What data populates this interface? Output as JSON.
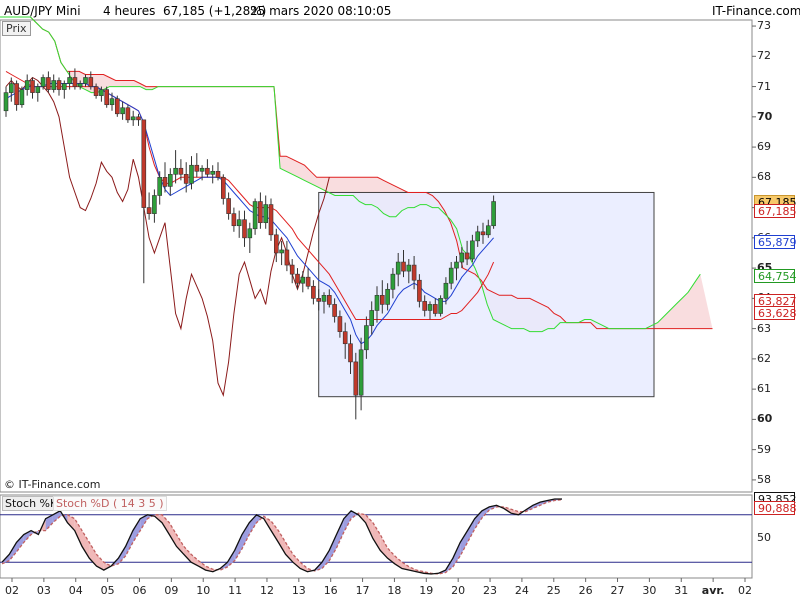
{
  "header": {
    "symbol": "AUD/JPY Mini",
    "timeframe": "4 heures",
    "last": "67,185 (+1,28%)",
    "datetime": "25 mars 2020 08:10:05",
    "brand": "IT-Finance.com",
    "price_tab": "Prix",
    "watermark": "© IT-Finance.com"
  },
  "stoch_legend": {
    "k_label": "Stoch %K",
    "d_label": "Stoch %D ( 14 3 5 )"
  },
  "colors": {
    "candle_up": "#2e9e3a",
    "candle_down": "#c0392b",
    "ma_fast": "#1f3fd1",
    "chikou": "#8b1a1a",
    "kijun_red": "#e02020",
    "senkou_green": "#33dd33",
    "cloud_fill": "#f8d9dc",
    "rect_fill": "#e8ecff",
    "stoch_k": "#111111",
    "stoch_d": "#c06060",
    "stoch_band": "#2a2a8a"
  },
  "price_labels": [
    {
      "text": "67,185",
      "value": 67.185,
      "color": "#000000",
      "bg": "#f7c96a"
    },
    {
      "text": "67,185",
      "value": 66.9,
      "color": "#cc2222",
      "bg": "#ffffff"
    },
    {
      "text": "65,879",
      "value": 65.879,
      "color": "#1f3fd1",
      "bg": "#ffffff"
    },
    {
      "text": "64,754",
      "value": 64.754,
      "color": "#229922",
      "bg": "#ffffff"
    },
    {
      "text": "63,827",
      "value": 63.92,
      "color": "#cc2222",
      "bg": "#ffffff"
    },
    {
      "text": "63,628",
      "value": 63.5,
      "color": "#cc2222",
      "bg": "#ffffff"
    }
  ],
  "stoch_labels": [
    {
      "text": "93,852",
      "value": 100,
      "color": "#111111"
    },
    {
      "text": "90,888",
      "value": 88,
      "color": "#cc2222"
    }
  ],
  "chart_data": {
    "type": "candlestick",
    "y_axis": {
      "ticks": [
        "73",
        "72",
        "71",
        "70",
        "69",
        "68",
        "67",
        "66",
        "65",
        "64",
        "63",
        "62",
        "61",
        "60",
        "59",
        "58"
      ],
      "bold": [
        "70",
        "65",
        "60"
      ],
      "range": [
        57.6,
        73.2
      ]
    },
    "x_axis": {
      "ticks": [
        "02",
        "03",
        "04",
        "05",
        "06",
        "09",
        "10",
        "11",
        "12",
        "13",
        "16",
        "17",
        "18",
        "19",
        "20",
        "23",
        "24",
        "25",
        "26",
        "27",
        "30",
        "31",
        "avr.",
        "02"
      ]
    },
    "stoch_axis": {
      "ticks": [
        "50"
      ],
      "range": [
        0,
        105
      ],
      "bands": [
        80,
        20
      ]
    },
    "candles": [
      [
        70.2,
        71.0,
        70.0,
        70.8
      ],
      [
        70.8,
        71.3,
        70.5,
        71.1
      ],
      [
        71.1,
        71.2,
        70.2,
        70.4
      ],
      [
        70.4,
        71.0,
        70.3,
        70.9
      ],
      [
        70.9,
        71.4,
        70.7,
        71.2
      ],
      [
        71.2,
        71.3,
        70.6,
        70.8
      ],
      [
        70.8,
        71.1,
        70.5,
        71.0
      ],
      [
        71.0,
        71.4,
        70.9,
        71.3
      ],
      [
        71.3,
        71.5,
        70.8,
        70.9
      ],
      [
        70.9,
        71.4,
        70.8,
        71.2
      ],
      [
        71.2,
        71.3,
        70.7,
        70.9
      ],
      [
        70.9,
        71.2,
        70.6,
        71.1
      ],
      [
        71.1,
        71.5,
        70.9,
        71.3
      ],
      [
        71.3,
        71.6,
        70.9,
        71.0
      ],
      [
        71.0,
        71.2,
        70.9,
        71.1
      ],
      [
        71.1,
        71.4,
        71.0,
        71.3
      ],
      [
        71.3,
        71.5,
        70.9,
        71.0
      ],
      [
        71.0,
        71.1,
        70.6,
        70.7
      ],
      [
        70.7,
        71.0,
        70.5,
        70.9
      ],
      [
        70.9,
        71.0,
        70.3,
        70.4
      ],
      [
        70.4,
        70.8,
        70.2,
        70.6
      ],
      [
        70.6,
        70.7,
        70.0,
        70.1
      ],
      [
        70.1,
        70.5,
        69.9,
        70.3
      ],
      [
        70.3,
        70.4,
        69.8,
        69.9
      ],
      [
        69.9,
        70.2,
        69.7,
        70.0
      ],
      [
        70.0,
        70.1,
        69.7,
        69.9
      ],
      [
        69.9,
        68.5,
        64.5,
        67.0
      ],
      [
        67.0,
        67.5,
        66.6,
        66.8
      ],
      [
        66.8,
        67.6,
        66.5,
        67.4
      ],
      [
        67.4,
        68.2,
        67.1,
        68.0
      ],
      [
        68.0,
        68.5,
        67.5,
        67.7
      ],
      [
        67.7,
        68.3,
        67.4,
        68.1
      ],
      [
        68.1,
        68.9,
        67.8,
        68.3
      ],
      [
        68.3,
        68.6,
        67.9,
        68.1
      ],
      [
        68.1,
        68.5,
        67.5,
        67.8
      ],
      [
        67.8,
        68.7,
        67.6,
        68.4
      ],
      [
        68.4,
        68.8,
        68.0,
        68.2
      ],
      [
        68.2,
        68.4,
        67.9,
        68.3
      ],
      [
        68.3,
        68.6,
        68.0,
        68.1
      ],
      [
        68.1,
        68.4,
        67.8,
        68.2
      ],
      [
        68.2,
        68.5,
        67.9,
        68.0
      ],
      [
        68.0,
        68.1,
        67.1,
        67.3
      ],
      [
        67.3,
        67.5,
        66.6,
        66.8
      ],
      [
        66.8,
        67.0,
        66.2,
        66.4
      ],
      [
        66.4,
        66.9,
        66.0,
        66.6
      ],
      [
        66.6,
        66.9,
        65.7,
        66.0
      ],
      [
        66.0,
        66.5,
        65.5,
        66.3
      ],
      [
        66.3,
        67.3,
        66.1,
        67.2
      ],
      [
        67.2,
        67.5,
        66.3,
        66.5
      ],
      [
        66.5,
        67.4,
        66.3,
        67.1
      ],
      [
        67.1,
        67.3,
        65.9,
        66.1
      ],
      [
        66.1,
        66.3,
        65.2,
        65.5
      ],
      [
        65.5,
        65.9,
        65.1,
        65.6
      ],
      [
        65.6,
        65.9,
        64.9,
        65.1
      ],
      [
        65.1,
        65.3,
        64.5,
        64.8
      ],
      [
        64.8,
        65.0,
        64.3,
        64.5
      ],
      [
        64.5,
        64.9,
        64.2,
        64.7
      ],
      [
        64.7,
        65.0,
        64.3,
        64.4
      ],
      [
        64.4,
        64.6,
        63.8,
        64.0
      ],
      [
        64.0,
        64.3,
        63.6,
        63.9
      ],
      [
        63.9,
        64.2,
        63.5,
        64.1
      ],
      [
        64.1,
        64.3,
        63.7,
        63.8
      ],
      [
        63.8,
        64.0,
        63.2,
        63.4
      ],
      [
        63.4,
        63.6,
        62.7,
        62.9
      ],
      [
        62.9,
        63.2,
        62.0,
        62.5
      ],
      [
        62.5,
        62.8,
        61.5,
        61.9
      ],
      [
        61.9,
        62.2,
        60.0,
        60.8
      ],
      [
        60.8,
        62.7,
        60.3,
        62.3
      ],
      [
        62.3,
        63.4,
        62.0,
        63.1
      ],
      [
        63.1,
        63.9,
        62.8,
        63.6
      ],
      [
        63.6,
        64.4,
        63.2,
        64.1
      ],
      [
        64.1,
        64.6,
        63.5,
        63.8
      ],
      [
        63.8,
        64.5,
        63.6,
        64.3
      ],
      [
        64.3,
        65.0,
        64.0,
        64.8
      ],
      [
        64.8,
        65.5,
        64.4,
        65.2
      ],
      [
        65.2,
        65.6,
        64.7,
        64.9
      ],
      [
        64.9,
        65.3,
        64.5,
        65.1
      ],
      [
        65.1,
        65.4,
        64.3,
        64.6
      ],
      [
        64.6,
        64.8,
        63.7,
        63.9
      ],
      [
        63.9,
        64.1,
        63.4,
        63.6
      ],
      [
        63.6,
        63.9,
        63.3,
        63.8
      ],
      [
        63.8,
        64.0,
        63.4,
        63.5
      ],
      [
        63.5,
        64.1,
        63.4,
        64.0
      ],
      [
        64.0,
        64.7,
        63.8,
        64.5
      ],
      [
        64.5,
        65.2,
        64.3,
        65.0
      ],
      [
        65.0,
        65.4,
        64.6,
        65.2
      ],
      [
        65.2,
        65.7,
        65.0,
        65.5
      ],
      [
        65.5,
        65.9,
        65.1,
        65.3
      ],
      [
        65.3,
        66.1,
        65.2,
        65.9
      ],
      [
        65.9,
        66.4,
        65.7,
        66.2
      ],
      [
        66.2,
        66.5,
        65.8,
        66.1
      ],
      [
        66.1,
        66.6,
        66.0,
        66.4
      ],
      [
        66.4,
        67.4,
        66.3,
        67.2
      ]
    ],
    "ma_fast": [
      70.6,
      70.7,
      70.8,
      70.9,
      71.0,
      71.0,
      71.0,
      71.0,
      71.1,
      71.1,
      71.1,
      71.1,
      71.1,
      71.1,
      71.1,
      71.1,
      71.0,
      71.0,
      70.9,
      70.8,
      70.7,
      70.6,
      70.5,
      70.4,
      70.3,
      70.2,
      69.8,
      69.2,
      68.6,
      68.0,
      67.6,
      67.4,
      67.5,
      67.6,
      67.7,
      67.8,
      67.9,
      68.0,
      68.0,
      68.0,
      68.0,
      67.9,
      67.7,
      67.5,
      67.3,
      67.1,
      66.9,
      66.8,
      66.7,
      66.7,
      66.6,
      66.4,
      66.2,
      66.0,
      65.7,
      65.4,
      65.2,
      65.0,
      64.8,
      64.6,
      64.5,
      64.4,
      64.2,
      63.9,
      63.6,
      63.3,
      62.8,
      62.5,
      62.6,
      62.8,
      63.1,
      63.3,
      63.5,
      63.8,
      64.1,
      64.3,
      64.4,
      64.5,
      64.4,
      64.2,
      64.1,
      64.0,
      63.9,
      63.9,
      64.1,
      64.4,
      64.7,
      64.9,
      65.1,
      65.4,
      65.6,
      65.8,
      66.0
    ],
    "chikou": [
      71.0,
      71.2,
      71.0,
      70.9,
      71.1,
      71.3,
      71.2,
      71.0,
      70.8,
      70.5,
      70.0,
      69.0,
      68.0,
      67.5,
      67.0,
      66.9,
      67.3,
      67.8,
      68.5,
      68.2,
      68.0,
      67.5,
      67.2,
      67.6,
      68.6,
      68.0,
      67.0,
      66.0,
      65.5,
      66.0,
      66.5,
      65.0,
      63.5,
      63.0,
      64.0,
      64.8,
      64.4,
      64.0,
      63.4,
      62.6,
      61.2,
      60.8,
      61.9,
      63.5,
      64.8,
      65.2,
      64.6,
      64.0,
      64.3,
      63.8,
      64.9,
      65.6,
      66.0,
      65.5,
      64.8,
      64.3,
      64.8,
      65.5,
      66.2,
      66.8,
      67.3,
      68.0
    ],
    "kijun": [
      71.5,
      71.4,
      71.3,
      71.2,
      71.1,
      71.0,
      71.0,
      71.0,
      71.0,
      71.0,
      71.0,
      71.0,
      71.0,
      71.0,
      71.0,
      71.0,
      71.0,
      71.0,
      70.9,
      70.8,
      70.7,
      70.6,
      70.5,
      70.4,
      70.3,
      70.2,
      69.8,
      69.0,
      68.4,
      68.0,
      67.8,
      67.8,
      67.9,
      68.0,
      68.0,
      68.0,
      68.0,
      68.0,
      68.0,
      68.0,
      68.0,
      68.0,
      67.9,
      67.7,
      67.5,
      67.3,
      67.1,
      67.0,
      67.0,
      67.0,
      67.0,
      66.9,
      66.7,
      66.5,
      66.3,
      66.0,
      65.8,
      65.6,
      65.4,
      65.2,
      65.0,
      64.8,
      64.5,
      64.2,
      63.9,
      63.6,
      63.3,
      63.3,
      63.3,
      63.3,
      63.3,
      63.3,
      63.3,
      63.3,
      63.3,
      63.3,
      63.3,
      63.3,
      63.3,
      63.3,
      63.3,
      63.3,
      63.3,
      63.4,
      63.5,
      63.5,
      63.6,
      63.8,
      64.0,
      64.2,
      64.5,
      64.8,
      65.2
    ],
    "senkou_b": [
      73.3,
      73.3,
      73.3,
      73.3,
      73.3,
      73.3,
      73.1,
      72.9,
      72.8,
      72.5,
      71.8,
      71.5,
      71.5,
      71.5,
      71.4,
      71.4,
      71.4,
      71.4,
      71.3,
      71.2,
      71.2,
      71.2,
      71.2,
      71.1,
      71.0,
      71.0,
      71.0,
      71.0,
      71.0,
      71.0,
      71.0,
      71.0,
      71.0,
      71.0,
      71.0,
      71.0,
      71.0,
      71.0,
      71.0,
      71.0,
      71.0,
      71.0,
      71.0,
      71.0,
      71.0,
      71.0,
      68.7,
      68.7,
      68.6,
      68.5,
      68.4,
      68.2,
      68.0,
      68.0,
      68.0,
      68.0,
      68.0,
      68.0,
      68.0,
      68.0,
      68.0,
      68.0,
      68.0,
      67.9,
      67.8,
      67.7,
      67.6,
      67.5,
      67.5,
      67.5,
      67.5,
      67.4,
      67.2,
      66.9,
      66.5,
      65.9,
      65.0,
      64.9,
      64.8,
      64.6,
      64.3,
      64.2,
      64.1,
      64.1,
      64.1,
      64.0,
      64.0,
      64.0,
      63.9,
      63.8,
      63.7,
      63.5,
      63.4,
      63.2,
      63.2,
      63.2,
      63.2,
      63.2,
      63.0,
      63.0,
      63.0,
      63.0,
      63.0,
      63.0,
      63.0,
      63.0,
      63.0,
      63.0,
      63.0,
      63.0,
      63.0,
      63.0,
      63.0,
      63.0,
      63.0,
      63.0,
      63.0,
      63.0
    ],
    "senkou_a": [
      73.3,
      73.3,
      73.3,
      73.3,
      73.3,
      73.3,
      73.1,
      72.9,
      72.8,
      72.5,
      71.8,
      71.5,
      71.2,
      71.0,
      70.9,
      70.8,
      70.8,
      70.9,
      71.0,
      71.0,
      71.0,
      71.0,
      71.0,
      71.0,
      70.9,
      70.9,
      71.0,
      71.0,
      71.0,
      71.0,
      71.0,
      71.0,
      71.0,
      71.0,
      71.0,
      71.0,
      71.0,
      71.0,
      71.0,
      71.0,
      71.0,
      71.0,
      71.0,
      71.0,
      71.0,
      71.0,
      68.3,
      68.2,
      68.1,
      68.0,
      67.9,
      67.8,
      67.7,
      67.6,
      67.5,
      67.4,
      67.4,
      67.4,
      67.4,
      67.2,
      67.1,
      67.1,
      67.0,
      66.8,
      66.7,
      66.7,
      66.9,
      67.0,
      67.0,
      67.1,
      67.1,
      67.0,
      67.0,
      66.8,
      66.6,
      66.3,
      65.6,
      65.4,
      65.0,
      64.5,
      63.8,
      63.3,
      63.2,
      63.1,
      63.0,
      63.0,
      63.0,
      62.9,
      62.9,
      62.9,
      63.0,
      63.0,
      63.2,
      63.2,
      63.2,
      63.2,
      63.3,
      63.3,
      63.2,
      63.1,
      63.0,
      63.0,
      63.0,
      63.0,
      63.0,
      63.0,
      63.0,
      63.1,
      63.2,
      63.4,
      63.6,
      63.8,
      64.0,
      64.2,
      64.5,
      64.8
    ],
    "rectangle": {
      "y_top": 67.5,
      "y_bottom": 60.75
    },
    "stoch_k": [
      20,
      30,
      45,
      55,
      60,
      55,
      75,
      80,
      85,
      70,
      60,
      40,
      25,
      15,
      10,
      15,
      25,
      40,
      60,
      75,
      80,
      78,
      70,
      55,
      40,
      30,
      20,
      15,
      10,
      8,
      12,
      20,
      35,
      55,
      70,
      80,
      75,
      60,
      45,
      30,
      20,
      12,
      8,
      10,
      20,
      35,
      55,
      75,
      85,
      80,
      70,
      50,
      35,
      25,
      18,
      12,
      10,
      8,
      6,
      5,
      6,
      10,
      25,
      45,
      60,
      75,
      85,
      90,
      92,
      88,
      82,
      80,
      86,
      92,
      96,
      98,
      100,
      100
    ],
    "stoch_d": [
      18,
      22,
      33,
      45,
      55,
      60,
      60,
      70,
      78,
      80,
      75,
      60,
      45,
      30,
      20,
      15,
      18,
      28,
      45,
      60,
      75,
      80,
      80,
      70,
      55,
      40,
      30,
      22,
      15,
      11,
      10,
      14,
      22,
      37,
      55,
      70,
      78,
      72,
      60,
      45,
      30,
      20,
      12,
      9,
      12,
      22,
      38,
      58,
      75,
      82,
      80,
      70,
      55,
      38,
      28,
      20,
      14,
      10,
      8,
      6,
      5,
      7,
      14,
      28,
      45,
      62,
      76,
      86,
      90,
      90,
      87,
      84,
      84,
      88,
      92,
      96,
      98,
      99
    ]
  }
}
